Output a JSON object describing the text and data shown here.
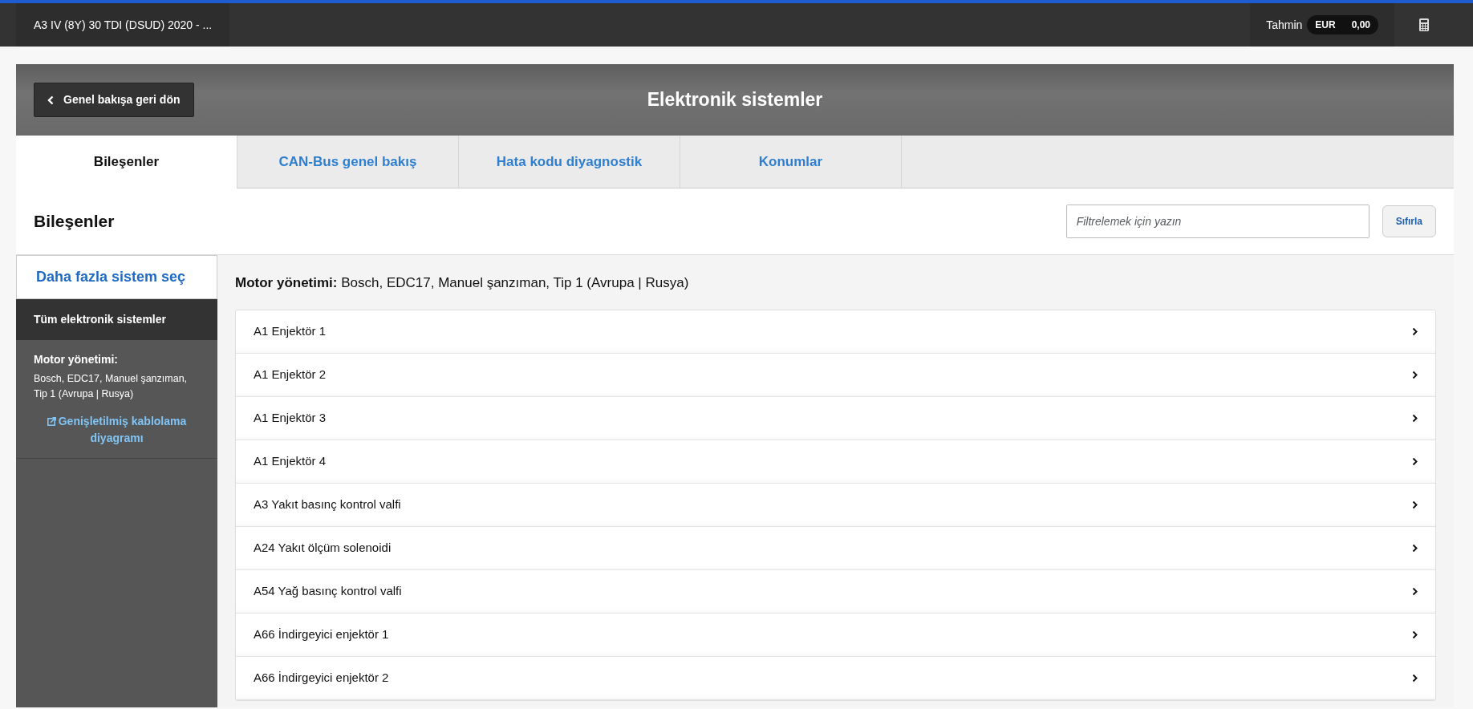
{
  "topbar": {
    "vehicle": "A3 IV (8Y) 30 TDI (DSUD) 2020 - ...",
    "estimate_label": "Tahmin",
    "currency": "EUR",
    "amount": "0,00"
  },
  "header": {
    "back_button": "Genel bakışa geri dön",
    "title": "Elektronik sistemler"
  },
  "tabs": [
    {
      "label": "Bileşenler",
      "selected": true
    },
    {
      "label": "CAN-Bus genel bakış",
      "selected": false
    },
    {
      "label": "Hata kodu diyagnostik",
      "selected": false
    },
    {
      "label": "Konumlar",
      "selected": false
    }
  ],
  "section": {
    "title": "Bileşenler",
    "filter": {
      "placeholder": "Filtrelemek için yazın"
    },
    "reset_button": "Sıfırla"
  },
  "sidebar": {
    "select_more": "Daha fazla sistem seç",
    "all_systems": "Tüm elektronik sistemler",
    "system_title": "Motor yönetimi:",
    "system_detail": "Bosch, EDC17, Manuel şanzıman, Tip 1 (Avrupa | Rusya)",
    "diagram_link": "Genişletilmiş kablolama diyagramı"
  },
  "main": {
    "heading": "**Motor yönetimi:** Bosch, EDC17, Manuel şanzıman, Tip 1 (Avrupa | Rusya)",
    "components": [
      "A1 Enjektör 1",
      "A1 Enjektör 2",
      "A1 Enjektör 3",
      "A1 Enjektör 4",
      "A3 Yakıt basınç kontrol valfi",
      "A24 Yakıt ölçüm solenoidi",
      "A54 Yağ basınç kontrol valfi",
      "A66 İndirgeyici enjektör 1",
      "A66 İndirgeyici enjektör 2"
    ]
  }
}
